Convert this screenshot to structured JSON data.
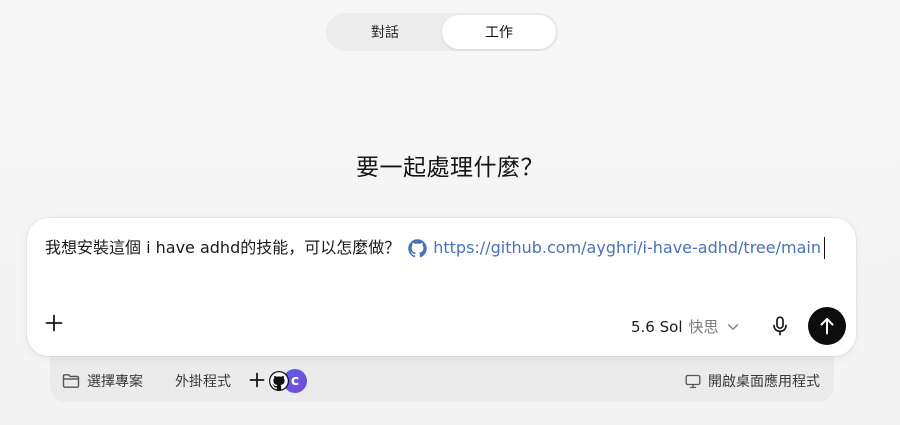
{
  "mode_toggle": {
    "tabs": [
      {
        "label": "對話",
        "active": false
      },
      {
        "label": "工作",
        "active": true
      }
    ]
  },
  "page_title": "要一起處理什麼？",
  "composer": {
    "message_text": "我想安裝這個 i have adhd的技能，可以怎麼做？",
    "link_text": "https://github.com/ayghri/i-have-adhd/tree/main",
    "link_icon": "github-icon",
    "model_name": "5.6 Sol",
    "model_mode": "快思",
    "icons": {
      "add": "plus-icon",
      "dropdown": "chevron-down-icon",
      "mic": "microphone-icon",
      "send": "arrow-up-icon"
    },
    "send_color": "#0d0d0d",
    "link_color": "#4a72b8"
  },
  "tool_bar": {
    "select_project_label": "選擇專案",
    "plugins_label": "外掛程式",
    "open_desktop_label": "開啟桌面應用程式",
    "c_badge_letter": "c",
    "icons": {
      "folder": "folder-icon",
      "add": "plus-icon",
      "github": "github-icon",
      "monitor": "monitor-icon"
    }
  }
}
